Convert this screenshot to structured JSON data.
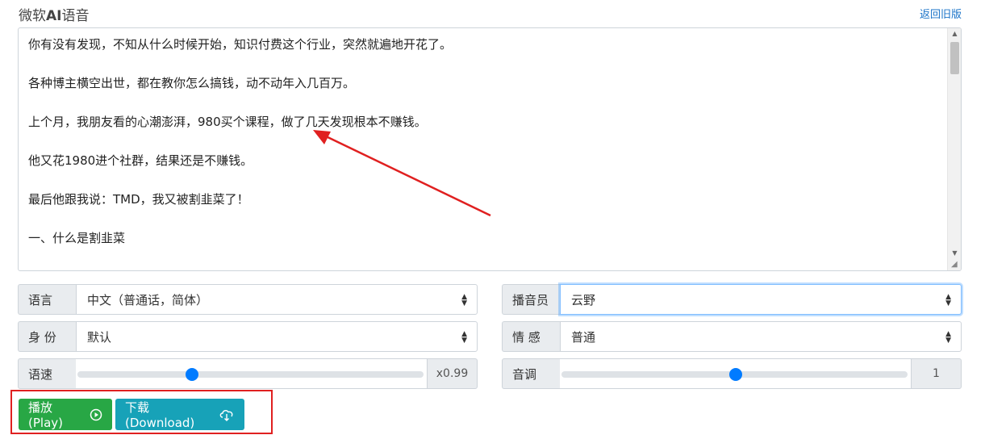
{
  "header": {
    "title_prefix": "微软",
    "title_bold": "AI",
    "title_suffix": "语音",
    "back_link": "返回旧版"
  },
  "textarea": {
    "paragraphs": [
      "你有没有发现，不知从什么时候开始，知识付费这个行业，突然就遍地开花了。",
      "各种博主横空出世，都在教你怎么搞钱，动不动年入几百万。",
      "上个月，我朋友看的心潮澎湃，980买个课程，做了几天发现根本不赚钱。",
      "他又花1980进个社群，结果还是不赚钱。",
      "最后他跟我说：TMD，我又被割韭菜了！",
      "一、什么是割韭菜"
    ]
  },
  "controls": {
    "language": {
      "label": "语言",
      "value": "中文（普通话，简体）"
    },
    "speaker": {
      "label": "播音员",
      "value": "云野"
    },
    "role": {
      "label": "身 份",
      "value": "默认"
    },
    "emotion": {
      "label": "情 感",
      "value": "普通"
    },
    "speed": {
      "label": "语速",
      "value_text": "x0.99",
      "fraction": 0.33
    },
    "pitch": {
      "label": "音调",
      "value_text": "1",
      "fraction": 0.5
    }
  },
  "buttons": {
    "play": "播放(Play)",
    "download": "下载(Download)"
  },
  "colors": {
    "play": "#28a745",
    "download": "#17a2b8",
    "slider": "#007bff",
    "annotation": "#e02020"
  },
  "icons": {
    "play": "play-circle-icon",
    "download": "cloud-download-icon"
  }
}
